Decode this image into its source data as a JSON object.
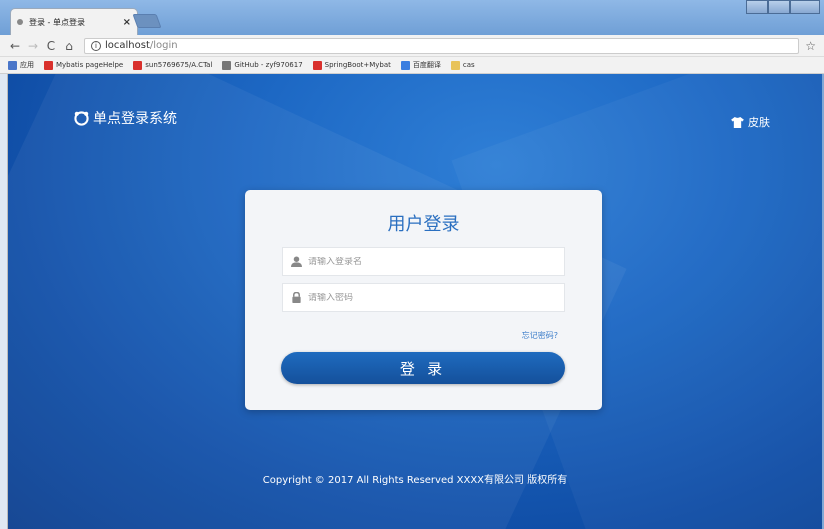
{
  "browser": {
    "tab_title": "登录 - 单点登录",
    "tab_close": "×",
    "url_host": "localhost",
    "url_path": "/login",
    "nav": {
      "back": "←",
      "forward": "→",
      "reload": "C",
      "home": "⌂",
      "star": "☆"
    },
    "bookmarks": [
      {
        "icon": "apps-icon",
        "label": "应用",
        "color": "#4a76c9"
      },
      {
        "icon": "c-icon",
        "label": "Mybatis pageHelpe",
        "color": "#d9302c"
      },
      {
        "icon": "g-icon",
        "label": "sun5769675/A.CTal",
        "color": "#d9302c"
      },
      {
        "icon": "page-icon",
        "label": "GitHub - zyf970617",
        "color": "#777777"
      },
      {
        "icon": "bm-icon",
        "label": "SpringBoot+Mybat",
        "color": "#d9302c"
      },
      {
        "icon": "translate-icon",
        "label": "百度翻译",
        "color": "#3a7ee0"
      },
      {
        "icon": "folder-icon",
        "label": "cas",
        "color": "#e8c35a"
      }
    ]
  },
  "page": {
    "brand": "单点登录系统",
    "skin_label": "皮肤",
    "login_title": "用户登录",
    "username_placeholder": "请输入登录名",
    "password_placeholder": "请输入密码",
    "forgot_password": "忘记密码?",
    "login_button": "登 录",
    "footer": "Copyright © 2017 All Rights Reserved XXXX有限公司 版权所有"
  },
  "colors": {
    "accent": "#1d68c4",
    "button": "#14509b",
    "title": "#2a6fc0"
  }
}
